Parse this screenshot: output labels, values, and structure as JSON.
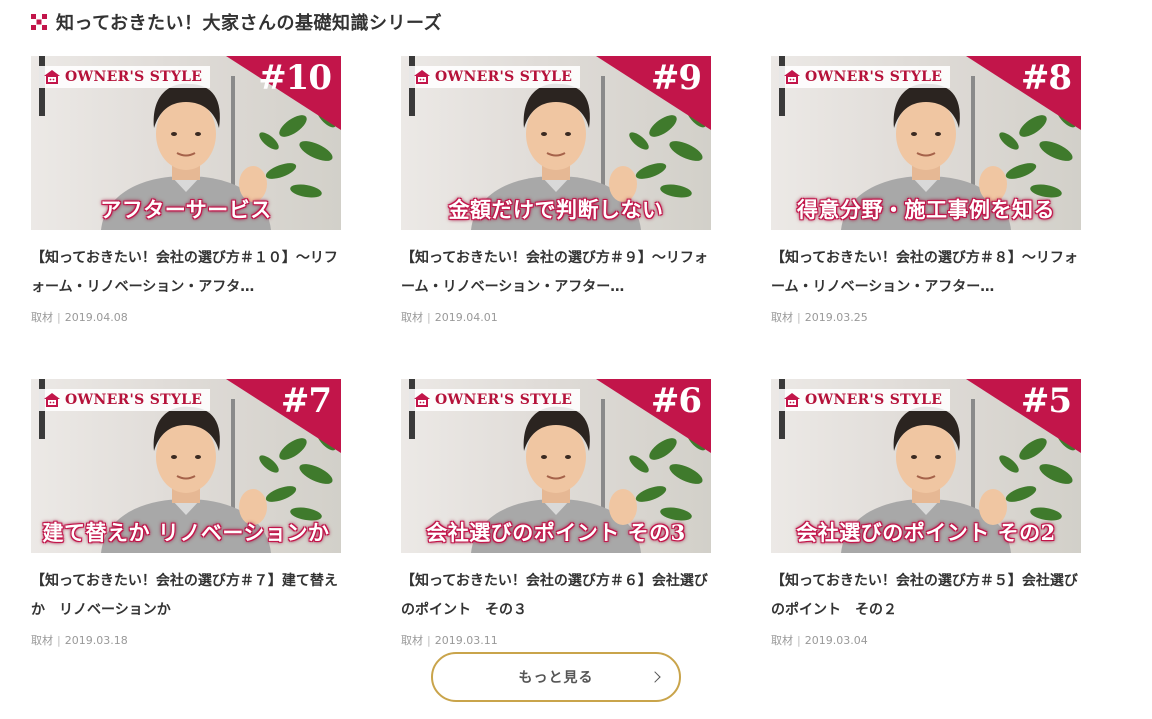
{
  "section": {
    "title": "知っておきたい！大家さんの基礎知識シリーズ",
    "icon": "checker-square-icon",
    "accent_color": "#c2154a"
  },
  "brand": {
    "name": "OWNER'S STYLE",
    "color": "#b5123a"
  },
  "cards": [
    {
      "episode": "#10",
      "caption": "アフターサービス",
      "title": "【知っておきたい！会社の選び方＃１０】～リフォーム・リノベーション・アフタ…",
      "category": "取材",
      "date": "2019.04.08"
    },
    {
      "episode": "#9",
      "caption": "金額だけで判断しない",
      "title": "【知っておきたい！会社の選び方＃９】～リフォーム・リノベーション・アフター…",
      "category": "取材",
      "date": "2019.04.01"
    },
    {
      "episode": "#8",
      "caption": "得意分野・施工事例を知る",
      "title": "【知っておきたい！会社の選び方＃８】～リフォーム・リノベーション・アフター…",
      "category": "取材",
      "date": "2019.03.25"
    },
    {
      "episode": "#7",
      "caption": "建て替えか リノベーションか",
      "title": "【知っておきたい！会社の選び方＃７】建て替えか　リノベーションか",
      "category": "取材",
      "date": "2019.03.18"
    },
    {
      "episode": "#6",
      "caption": "会社選びのポイント その3",
      "title": "【知っておきたい！会社の選び方＃６】会社選びのポイント　その３",
      "category": "取材",
      "date": "2019.03.11"
    },
    {
      "episode": "#5",
      "caption": "会社選びのポイント その2",
      "title": "【知っておきたい！会社の選び方＃５】会社選びのポイント　その２",
      "category": "取材",
      "date": "2019.03.04"
    }
  ],
  "more_button": {
    "label": "もっと見る",
    "border_color": "#c9a44b"
  }
}
